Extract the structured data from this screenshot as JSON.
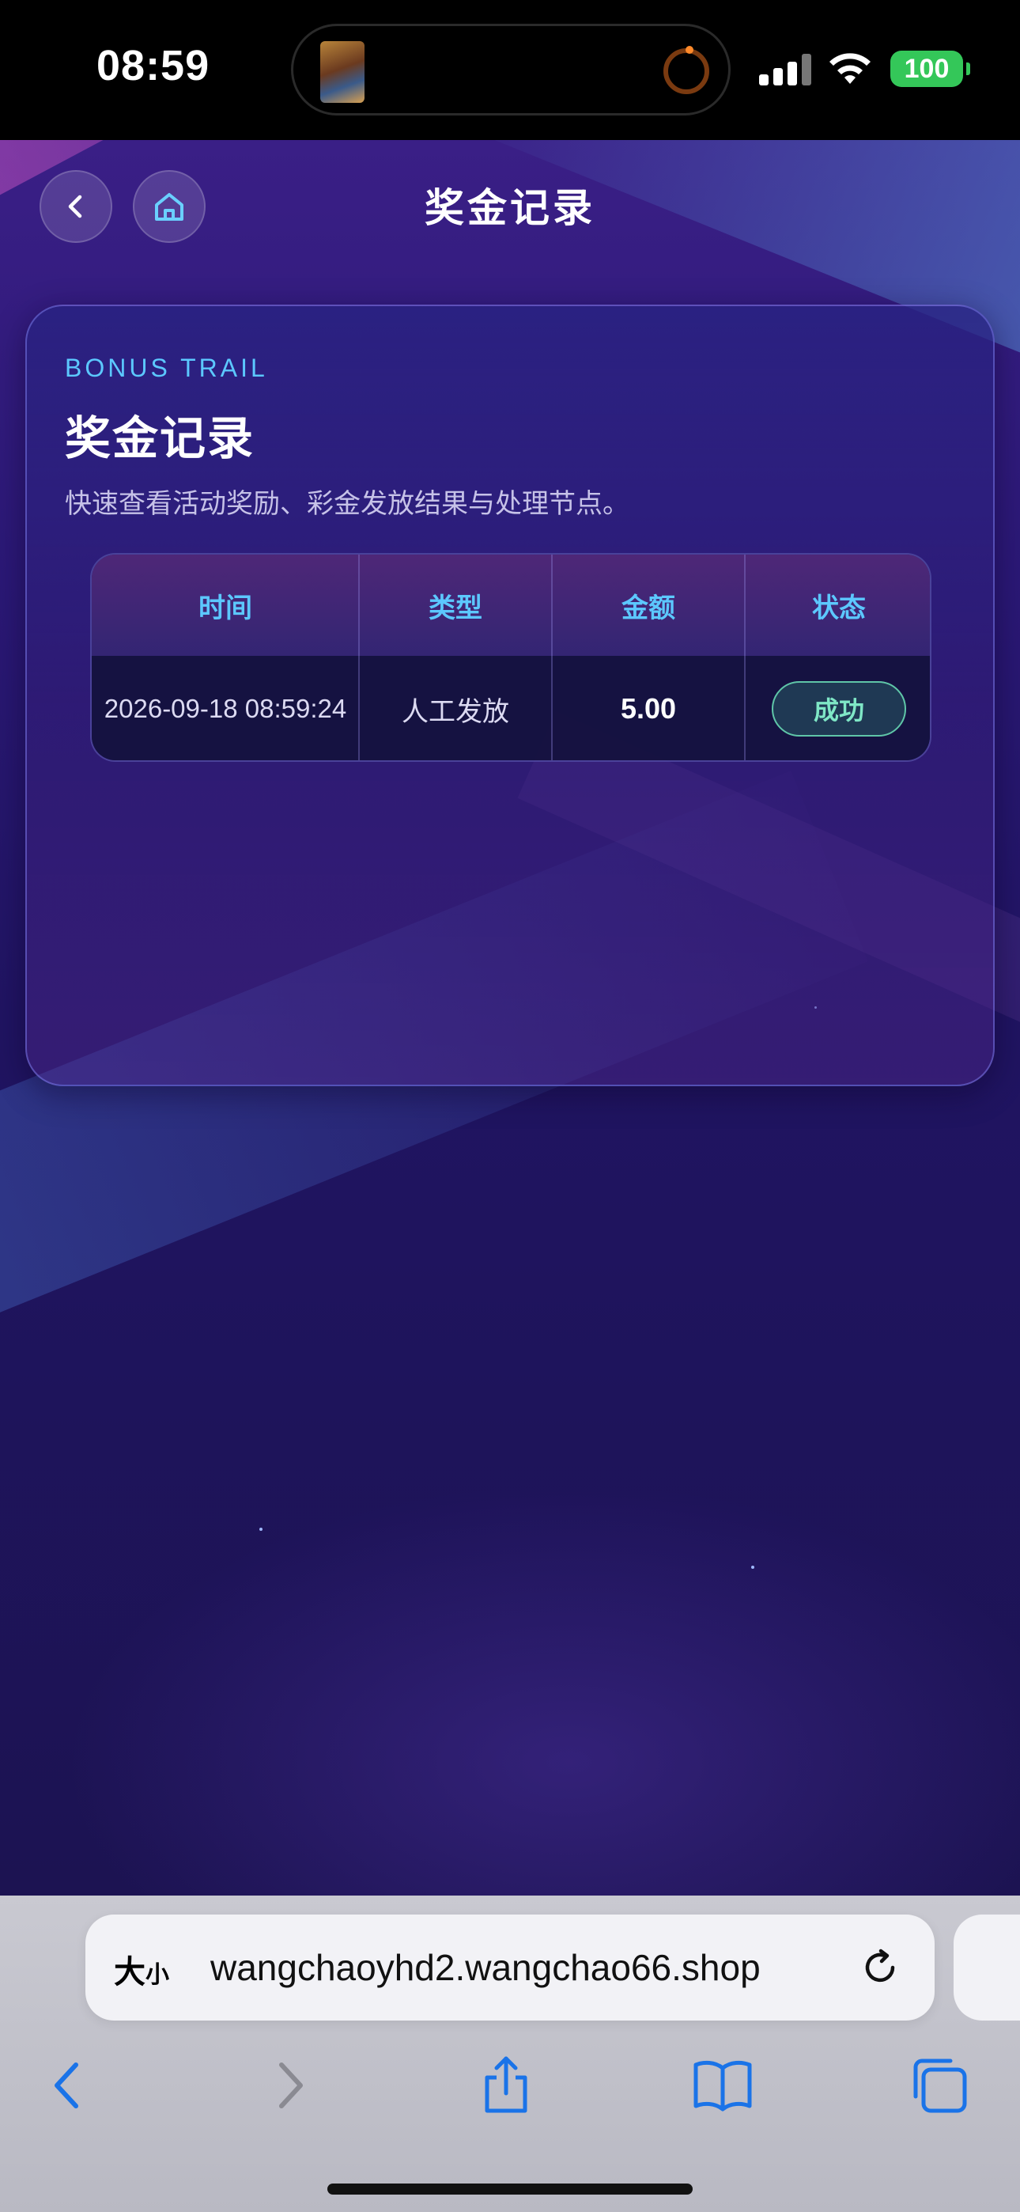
{
  "status_bar": {
    "time": "08:59",
    "battery": "100"
  },
  "header": {
    "title": "奖金记录",
    "back_icon": "chevron-left-icon",
    "home_icon": "house-icon"
  },
  "card": {
    "kicker": "BONUS TRAIL",
    "title": "奖金记录",
    "subtitle": "快速查看活动奖励、彩金发放结果与处理节点。",
    "table": {
      "columns": [
        "时间",
        "类型",
        "金额",
        "状态"
      ],
      "rows": [
        {
          "time": "2026-09-18 08:59:24",
          "type": "人工发放",
          "amount": "5.00",
          "status": "成功"
        }
      ]
    }
  },
  "browser": {
    "text_size_label": "大",
    "text_size_small": "小",
    "url": "wangchaoyhd2.wangchao66.shop",
    "toolbar_icons": [
      "back-icon",
      "forward-icon",
      "share-icon",
      "bookmarks-icon",
      "tabs-icon"
    ]
  },
  "colors": {
    "accent": "#5cc8ff",
    "success": "#7fe7c6",
    "battery": "#34c759"
  }
}
